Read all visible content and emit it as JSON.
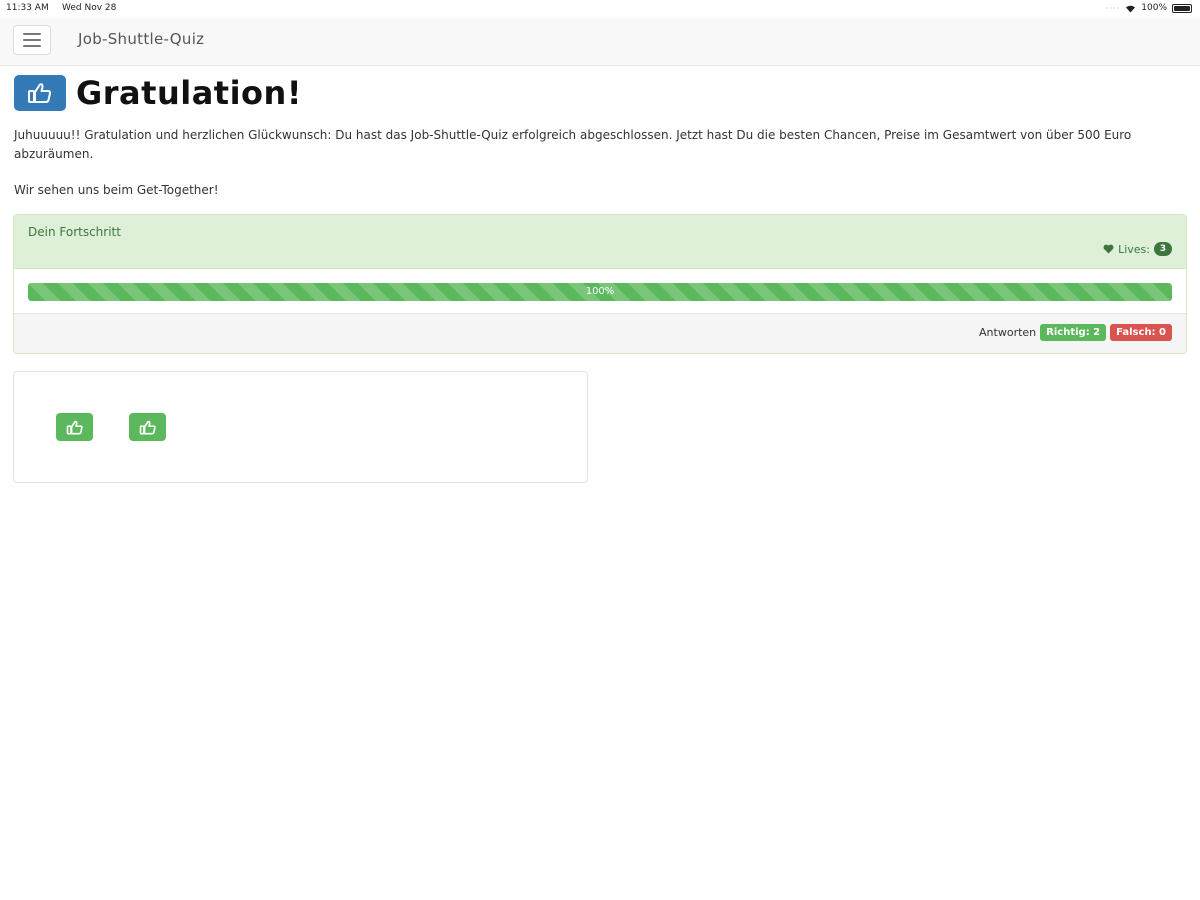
{
  "status_bar": {
    "time": "11:33 AM",
    "date": "Wed Nov 28",
    "battery": "100%",
    "wifi_icon": "wifi-icon",
    "battery_icon": "battery-icon"
  },
  "navbar": {
    "brand": "Job-Shuttle-Quiz",
    "menu_icon": "hamburger-menu-icon"
  },
  "heading": {
    "icon": "thumbs-up-icon",
    "title": "Gratulation!"
  },
  "intro_text": "Juhuuuuu!! Gratulation und herzlichen Glückwunsch: Du hast das Job-Shuttle-Quiz erfolgreich abgeschlossen. Jetzt hast Du die besten Chancen, Preise im Gesamtwert von über 500 Euro abzuräumen.",
  "outro_text": "Wir sehen uns beim Get-Together!",
  "progress_panel": {
    "title": "Dein Fortschritt",
    "lives_label": "Lives:",
    "lives_count": "3",
    "heart_icon": "heart-icon",
    "progress_value": 1.0,
    "progress_label": "100%",
    "answers_label": "Antworten",
    "correct_label": "Richtig: 2",
    "wrong_label": "Falsch: 0"
  },
  "thumbs": [
    {
      "icon": "thumbs-up-icon"
    },
    {
      "icon": "thumbs-up-icon"
    }
  ],
  "colors": {
    "primary": "#337ab7",
    "success": "#5cb85c",
    "danger": "#d9534f",
    "panel_success_bg": "#dff0d8",
    "panel_success_text": "#3c763d"
  }
}
